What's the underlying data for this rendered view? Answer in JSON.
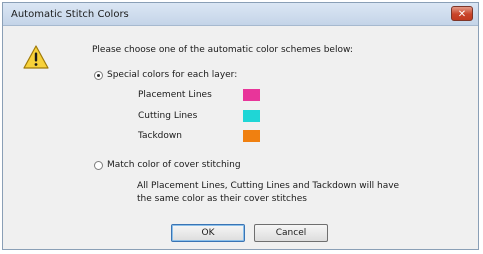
{
  "window": {
    "title": "Automatic Stitch Colors",
    "close_symbol": "✕",
    "icon": "warning-icon"
  },
  "dialog": {
    "prompt": "Please choose one of the automatic color schemes below:",
    "options": {
      "special": {
        "label": "Special colors for each layer:",
        "checked": true
      },
      "match": {
        "label": "Match color of cover stitching",
        "checked": false
      }
    },
    "layers": [
      {
        "label": "Placement Lines",
        "color": "#e8359a"
      },
      {
        "label": "Cutting Lines",
        "color": "#1fd6d6"
      },
      {
        "label": "Tackdown",
        "color": "#f08010"
      }
    ],
    "match_description_line1": "All Placement Lines, Cutting Lines and Tackdown will have",
    "match_description_line2": "the same color as their cover stitches"
  },
  "buttons": {
    "ok": "OK",
    "cancel": "Cancel"
  }
}
